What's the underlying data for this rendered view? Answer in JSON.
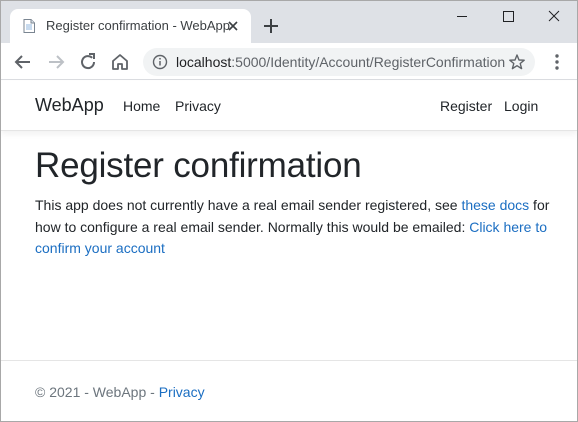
{
  "browser": {
    "tab_title": "Register confirmation - WebApp",
    "url_host": "localhost",
    "url_path": ":5000/Identity/Account/RegisterConfirmation"
  },
  "navbar": {
    "brand": "WebApp",
    "links": {
      "home": "Home",
      "privacy": "Privacy",
      "register": "Register",
      "login": "Login"
    }
  },
  "content": {
    "heading": "Register confirmation",
    "text_before_link": "This app does not currently have a real email sender registered, see ",
    "docs_link": "these docs",
    "text_after_link": " for how to configure a real email sender. Normally this would be emailed: ",
    "confirm_link": "Click here to confirm your account"
  },
  "footer": {
    "copyright": "© 2021 - WebApp - ",
    "privacy_link": "Privacy"
  },
  "colors": {
    "link": "#1b6ec2",
    "tabstrip": "#dee1e6",
    "omnibox": "#f1f3f4"
  },
  "icons": [
    "file-icon",
    "close-icon",
    "plus-icon",
    "minimize-icon",
    "maximize-icon",
    "window-close-icon",
    "back-arrow-icon",
    "forward-arrow-icon",
    "reload-icon",
    "home-icon",
    "info-icon",
    "star-icon",
    "menu-dots-icon"
  ]
}
